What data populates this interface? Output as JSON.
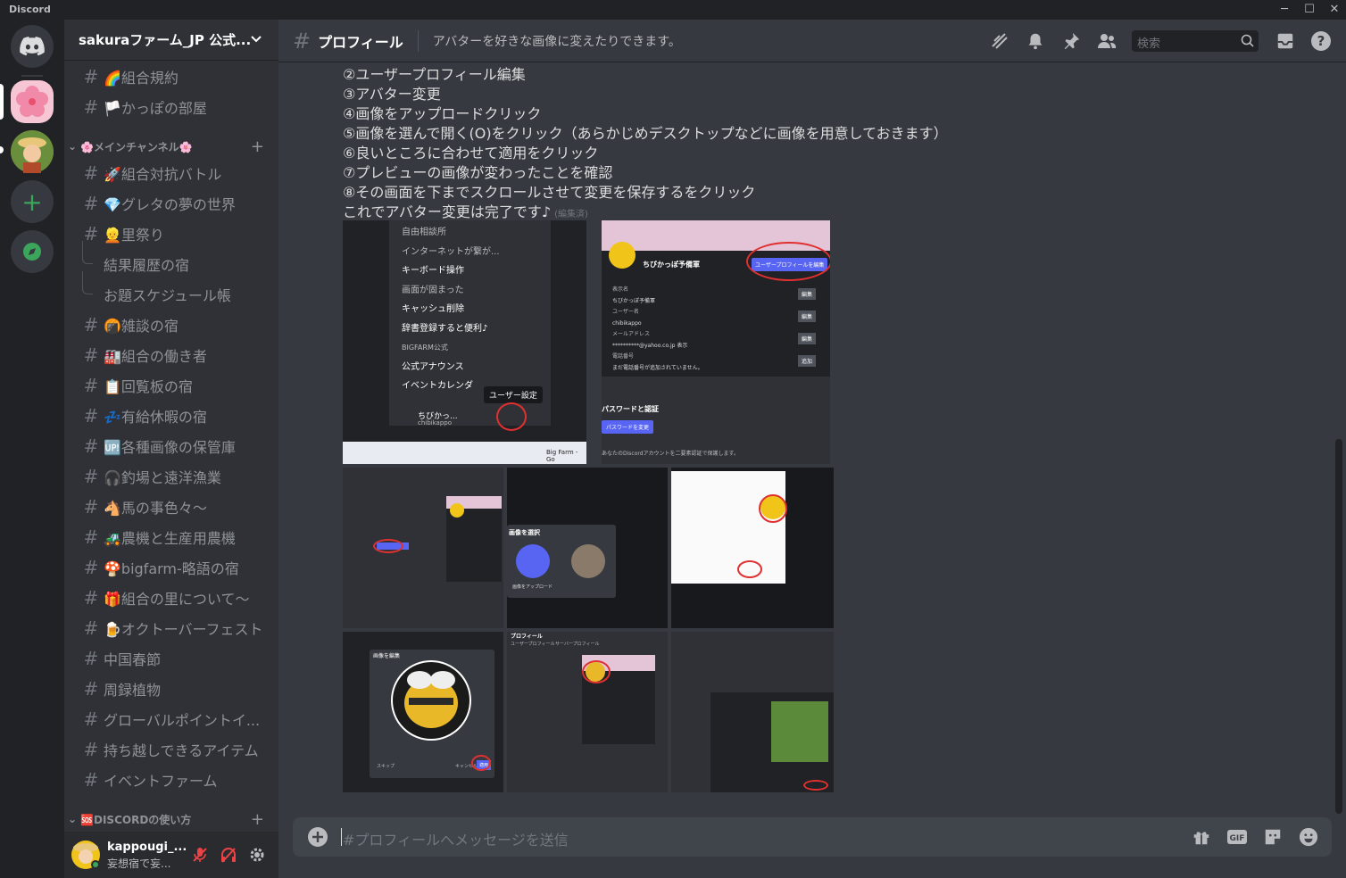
{
  "app": {
    "name": "Discord"
  },
  "window_controls": {
    "minimize": "─",
    "maximize": "☐",
    "close": "✕"
  },
  "server": {
    "name": "sakuraファーム_JP 公式...",
    "chevron": "⌄"
  },
  "channels": {
    "top": [
      {
        "label": "🌈組合規約"
      },
      {
        "label": "🏳️かっぽの部屋"
      }
    ],
    "category1": "🌸メインチャンネル🌸",
    "main": [
      {
        "label": "🚀組合対抗バトル"
      },
      {
        "label": "💎グレタの夢の世界"
      },
      {
        "label": "👱里祭り"
      }
    ],
    "threads": [
      {
        "label": "結果履歴の宿"
      },
      {
        "label": "お題スケジュール帳"
      }
    ],
    "more": [
      {
        "label": "🍘雑談の宿"
      },
      {
        "label": "🏭組合の働き者"
      },
      {
        "label": "📋回覧板の宿"
      },
      {
        "label": "💤有給休暇の宿"
      },
      {
        "label": "🆙各種画像の保管庫"
      },
      {
        "label": "🎧釣場と遠洋漁業"
      },
      {
        "label": "🐴馬の事色々～"
      },
      {
        "label": "🚜農機と生産用農機"
      },
      {
        "label": "🍄bigfarm-略語の宿"
      },
      {
        "label": "🎁組合の里について～"
      },
      {
        "label": "🍺オクトーバーフェスト"
      },
      {
        "label": "中国春節"
      },
      {
        "label": "周録植物"
      },
      {
        "label": "グローバルポイントイ..."
      },
      {
        "label": "持ち越しできるアイテム"
      },
      {
        "label": "イベントファーム"
      }
    ],
    "category2": "🆘DISCORDの使い方"
  },
  "user": {
    "name": "kappougi_...",
    "status": "妄想宿で妄..."
  },
  "channel_header": {
    "hash": "#",
    "name": "プロフィール",
    "topic": "アバターを好きな画像に変えたりできます。",
    "search_placeholder": "検索"
  },
  "message": {
    "lines": [
      "②ユーザープロフィール編集",
      "③アバター変更",
      "④画像をアップロードクリック",
      "⑤画像を選んで開く(O)をクリック（あらかじめデスクトップなどに画像を用意しておきます）",
      "⑥良いところに合わせて適用をクリック",
      "⑦プレビューの画像が変わったことを確認",
      "⑧その画面を下までスクロールさせて変更を保存するをクリック",
      "これでアバター変更は完了です♪"
    ],
    "edited": "(編集済)"
  },
  "thumb1": {
    "items": [
      "自由相談所",
      "インターネットが繋が...",
      "キーボード操作",
      "画面が固まった",
      "キャッシュ削除",
      "辞書登録すると便利♪"
    ],
    "category": "BIGFARM公式",
    "items2": [
      "公式アナウンス",
      "イベントカレンダ"
    ],
    "tooltip": "ユーザー設定",
    "user": "ちびかっ...",
    "userid": "chibikappo",
    "taskbar_label": "Big Farm - Go"
  },
  "thumb2": {
    "name": "ちびかっぽ予備軍",
    "edit_btn": "ユーザープロフィールを編集",
    "fields": [
      {
        "label": "表示名",
        "value": "ちびかっぽ予備軍",
        "btn": "編集"
      },
      {
        "label": "ユーザー名",
        "value": "chibikappo",
        "btn": "編集"
      },
      {
        "label": "メールアドレス",
        "value": "**********@yahoo.co.jp 表示",
        "btn": "編集"
      },
      {
        "label": "電話番号",
        "value": "まだ電話番号が追加されていません。",
        "btn": "追加"
      }
    ],
    "section": "パスワードと認証",
    "pw_btn": "パスワードを変更",
    "note": "あなたのDiscordアカウントを二要素認証で保護します。"
  },
  "thumb4": {
    "title": "画像を選択",
    "upload": "画像をアップロード"
  },
  "thumb7": {
    "title": "画像を編集",
    "skip": "スキップ",
    "cancel": "キャンセル",
    "apply": "適用"
  },
  "thumb8": {
    "title": "プロフィール",
    "tab1": "ユーザープロフィール",
    "tab2": "サーバープロフィール"
  },
  "composer": {
    "placeholder": "#プロフィールへメッセージを送信"
  }
}
